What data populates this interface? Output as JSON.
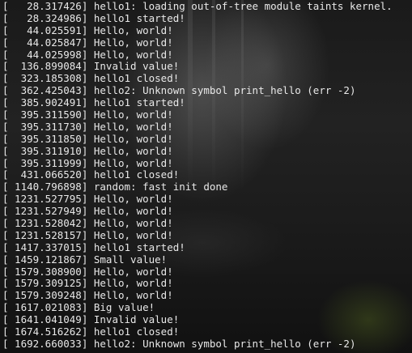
{
  "terminal": {
    "lines": [
      "[   28.317426] hello1: loading out-of-tree module taints kernel.",
      "[   28.324986] hello1 started!",
      "[   44.025591] Hello, world!",
      "[   44.025847] Hello, world!",
      "[   44.025998] Hello, world!",
      "[  136.899084] Invalid value!",
      "[  323.185308] hello1 closed!",
      "[  362.425043] hello2: Unknown symbol print_hello (err -2)",
      "[  385.902491] hello1 started!",
      "[  395.311590] Hello, world!",
      "[  395.311730] Hello, world!",
      "[  395.311850] Hello, world!",
      "[  395.311910] Hello, world!",
      "[  395.311999] Hello, world!",
      "[  431.066520] hello1 closed!",
      "[ 1140.796898] random: fast init done",
      "[ 1231.527795] Hello, world!",
      "[ 1231.527949] Hello, world!",
      "[ 1231.528042] Hello, world!",
      "[ 1231.528157] Hello, world!",
      "[ 1417.337015] hello1 started!",
      "[ 1459.121867] Small value!",
      "[ 1579.308900] Hello, world!",
      "[ 1579.309125] Hello, world!",
      "[ 1579.309248] Hello, world!",
      "[ 1617.021083] Big value!",
      "[ 1641.041049] Invalid value!",
      "[ 1674.516262] hello1 closed!",
      "[ 1692.660033] hello2: Unknown symbol print_hello (err -2)"
    ]
  },
  "colors": {
    "text": "#e8e8e8",
    "background": "#151515"
  }
}
